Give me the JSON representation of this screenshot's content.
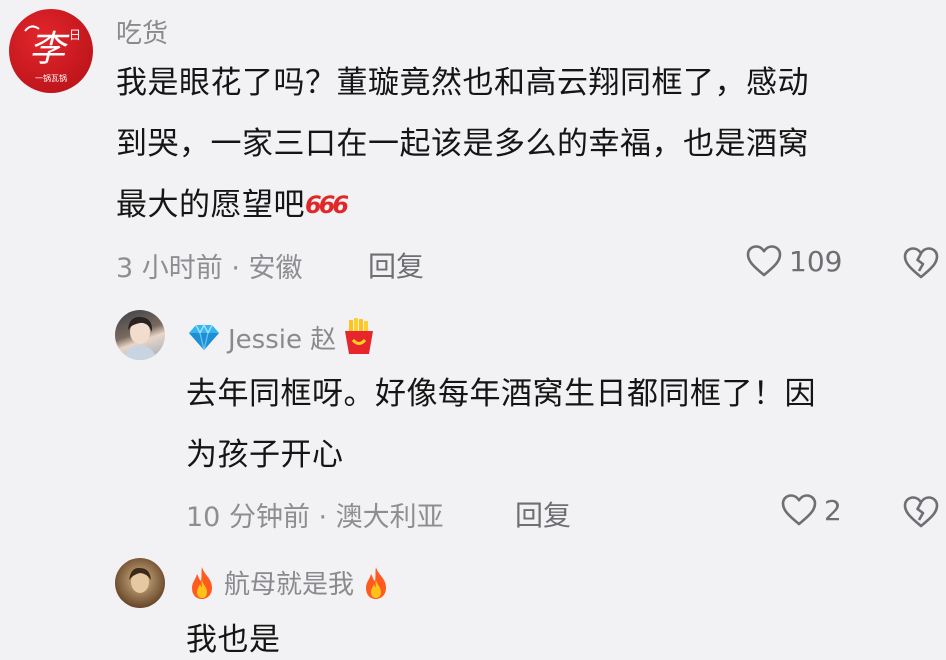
{
  "comments": [
    {
      "name": "吃货",
      "avatar_char": "李",
      "avatar_sub": "日",
      "avatar_caption": "一锅瓦锅",
      "text_lines": [
        "我是眼花了吗？董璇竟然也和高云翔同框了，感动",
        "到哭，一家三口在一起该是多么的幸福，也是酒窝",
        "最大的愿望吧"
      ],
      "emoji": "666",
      "time_location": "3 小时前 · 安徽",
      "reply_label": "回复",
      "likes": "109"
    },
    {
      "name": "Jessie 赵",
      "text_lines": [
        "去年同框呀。好像每年酒窝生日都同框了！因",
        "为孩子开心"
      ],
      "time_location": "10 分钟前 · 澳大利亚",
      "reply_label": "回复",
      "likes": "2"
    },
    {
      "name": "航母就是我",
      "text_lines": [
        "我也是"
      ]
    }
  ],
  "icons": {
    "heart": "heart-outline-icon",
    "dislike": "broken-heart-icon",
    "diamond": "diamond-badge-icon",
    "fries": "fries-badge-icon",
    "fire": "fire-icon"
  },
  "colors": {
    "background": "#f2f2f4",
    "meta_gray": "#8e8e92",
    "avatar_red": "#c8171e",
    "diamond_blue": "#2aa6e8"
  }
}
